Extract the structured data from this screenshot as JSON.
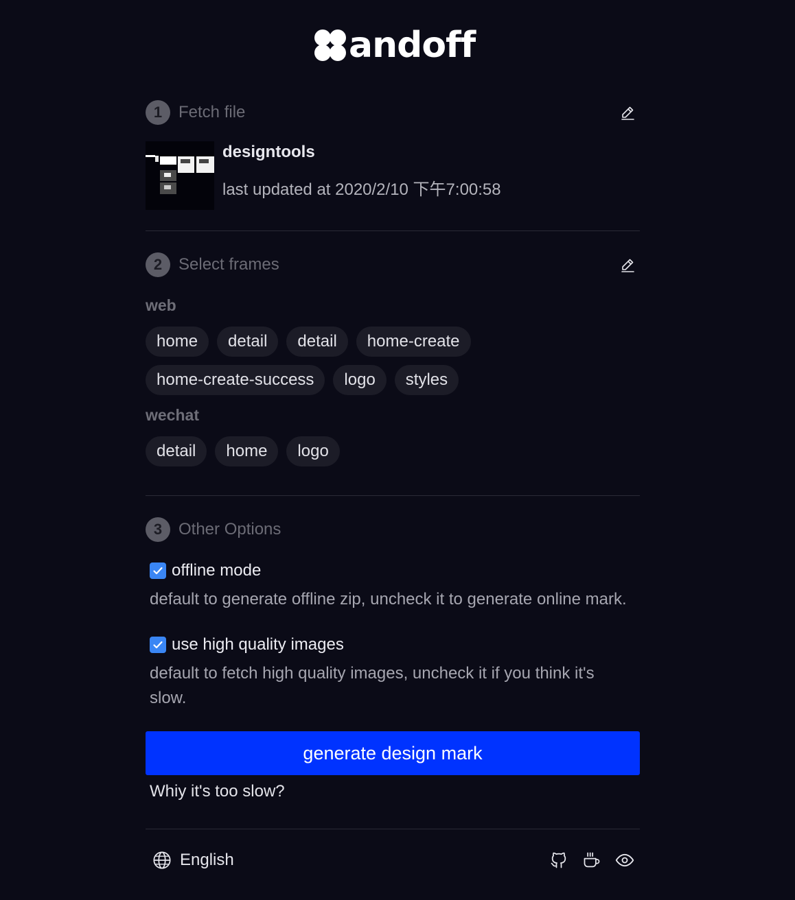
{
  "brand": {
    "name": "andoff"
  },
  "steps": {
    "fetch": {
      "number": "1",
      "title": "Fetch file",
      "file_name": "designtools",
      "file_meta": "last updated at 2020/2/10 下午7:00:58"
    },
    "frames": {
      "number": "2",
      "title": "Select frames",
      "groups": [
        {
          "label": "web",
          "rows": [
            [
              "home",
              "detail",
              "detail",
              "home-create"
            ],
            [
              "home-create-success",
              "logo",
              "styles"
            ]
          ]
        },
        {
          "label": "wechat",
          "rows": [
            [
              "detail",
              "home",
              "logo"
            ]
          ]
        }
      ]
    },
    "options": {
      "number": "3",
      "title": "Other Options",
      "items": [
        {
          "label": "offline mode",
          "checked": true,
          "description": "default to generate offline zip, uncheck it to generate online mark."
        },
        {
          "label": "use high quality images",
          "checked": true,
          "description": "default to fetch high quality images, uncheck it if you think it's slow."
        }
      ]
    }
  },
  "actions": {
    "generate_label": "generate design mark",
    "help_link": "Whiy it's too slow?"
  },
  "footer": {
    "language": "English",
    "icons": [
      "github-icon",
      "coffee-icon",
      "eye-icon"
    ]
  },
  "colors": {
    "background": "#0b0b17",
    "primary": "#0033ff",
    "checkbox": "#3a86f4",
    "chip": "#1c1c27"
  }
}
